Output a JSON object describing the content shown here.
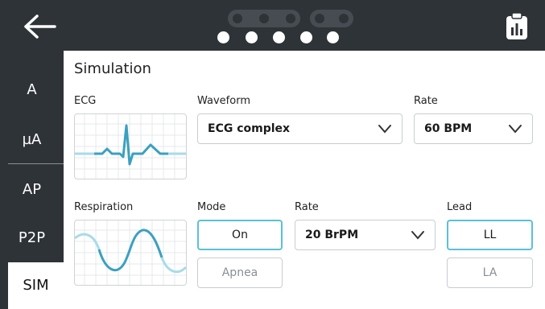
{
  "header": {
    "back_icon": "arrow-left-icon",
    "clipboard_icon": "clipboard-chart-icon",
    "page_dots": {
      "total": 5,
      "active": 0
    }
  },
  "sidebar": {
    "items": [
      {
        "label": "A"
      },
      {
        "label": "µA"
      },
      {
        "label": "AP"
      },
      {
        "label": "P2P"
      },
      {
        "label": "SIM"
      }
    ],
    "active": "SIM"
  },
  "main": {
    "title": "Simulation",
    "ecg": {
      "label": "ECG",
      "waveform_label": "Waveform",
      "waveform_value": "ECG complex",
      "rate_label": "Rate",
      "rate_value": "60 BPM"
    },
    "respiration": {
      "label": "Respiration",
      "mode_label": "Mode",
      "mode_on": "On",
      "mode_apnea": "Apnea",
      "rate_label": "Rate",
      "rate_value": "20 BrPM",
      "lead_label": "Lead",
      "lead_ll": "LL",
      "lead_la": "LA"
    }
  },
  "colors": {
    "topbar": "#2e3338",
    "accent": "#5cc0d6",
    "wave": "#3ba0c0",
    "wave_light": "#a8dbe8"
  }
}
